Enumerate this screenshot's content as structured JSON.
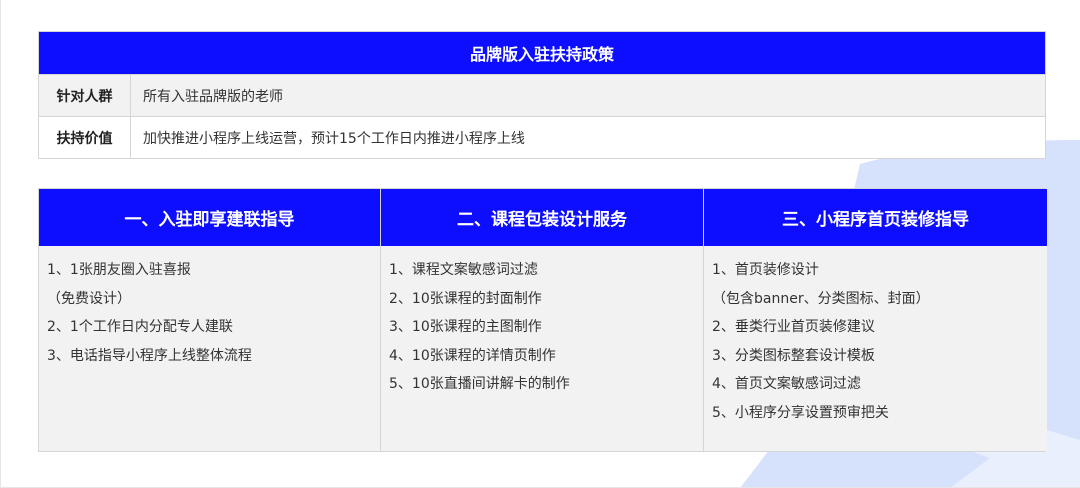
{
  "colors": {
    "header_blue": "#0d0dff",
    "cell_gray": "#f2f2f2",
    "bg_shape": "#d6e1fb"
  },
  "policy": {
    "title": "品牌版入驻扶持政策",
    "rows": [
      {
        "key": "针对人群",
        "value": "所有入驻品牌版的老师"
      },
      {
        "key": "扶持价值",
        "value": "加快推进小程序上线运营，预计15个工作日内推进小程序上线"
      }
    ]
  },
  "services": [
    {
      "header": "一、入驻即享建联指导",
      "lines": [
        "1、1张朋友圈入驻喜报",
        "（免费设计）",
        "2、1个工作日内分配专人建联",
        "3、电话指导小程序上线整体流程"
      ]
    },
    {
      "header": "二、课程包装设计服务",
      "lines": [
        "1、课程文案敏感词过滤",
        "2、10张课程的封面制作",
        "3、10张课程的主图制作",
        "4、10张课程的详情页制作",
        "5、10张直播间讲解卡的制作"
      ]
    },
    {
      "header": "三、小程序首页装修指导",
      "lines": [
        "1、首页装修设计",
        "（包含banner、分类图标、封面）",
        "2、垂类行业首页装修建议",
        "3、分类图标整套设计模板",
        "4、首页文案敏感词过滤",
        "5、小程序分享设置预审把关"
      ]
    }
  ]
}
